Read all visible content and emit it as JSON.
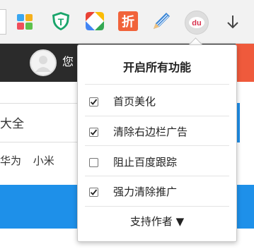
{
  "page": {
    "user_text": "您",
    "search_text": "大全",
    "hot_links": [
      "华为",
      "小米"
    ]
  },
  "popup": {
    "title": "开启所有功能",
    "options": [
      {
        "label": "首页美化",
        "checked": true
      },
      {
        "label": "清除右边栏广告",
        "checked": true
      },
      {
        "label": "阻止百度跟踪",
        "checked": false
      },
      {
        "label": "强力清除推广",
        "checked": true
      }
    ],
    "support_author": "支持作者 ▼"
  },
  "toolbar": {
    "extensions": [
      {
        "icon": "colorful-grid-icon"
      },
      {
        "icon": "green-shield-t-icon",
        "glyph": "T"
      },
      {
        "icon": "lightning-bolt-icon"
      },
      {
        "icon": "zhe-discount-icon",
        "glyph": "折"
      },
      {
        "icon": "pencil-icon"
      },
      {
        "icon": "baidu-du-icon",
        "glyph": "du"
      },
      {
        "icon": "download-arrow-icon"
      }
    ]
  },
  "colors": {
    "page_dark_bar": "#2b2b2b",
    "page_accent": "#ef5a3c",
    "page_blue": "#1e90e9",
    "shield_green": "#1aa56b",
    "zhe_orange": "#f1633a",
    "du_red": "#d8334f",
    "pencil_blue": "#3d87d6"
  }
}
